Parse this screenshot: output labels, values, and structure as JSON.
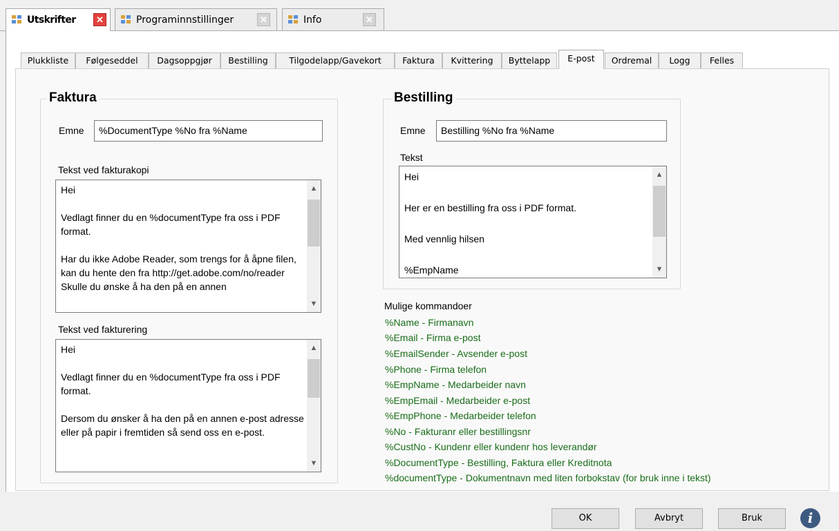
{
  "doc_tabs": [
    {
      "label": "Utskrifter",
      "active": true
    },
    {
      "label": "Programinnstillinger",
      "active": false
    },
    {
      "label": "Info",
      "active": false
    }
  ],
  "inner_tabs": [
    "Plukkliste",
    "Følgeseddel",
    "Dagsoppgjør",
    "Bestilling",
    "Tilgodelapp/Gavekort",
    "Faktura",
    "Kvittering",
    "Byttelapp",
    "E-post",
    "Ordremal",
    "Logg",
    "Felles"
  ],
  "active_inner_tab": "E-post",
  "faktura": {
    "title": "Faktura",
    "subject_label": "Emne",
    "subject_value": "%DocumentType %No fra %Name",
    "copy_label": "Tekst ved fakturakopi",
    "copy_text": "Hei\n\nVedlagt finner du en %documentType fra oss i PDF format.\n\nHar du ikke Adobe Reader, som trengs for å åpne filen, kan du hente den fra http://get.adobe.com/no/reader\nSkulle du ønske å ha den på en annen",
    "invoice_label": "Tekst ved fakturering",
    "invoice_text": "Hei\n\nVedlagt finner du en %documentType fra oss i PDF format.\n\nDersom du ønsker å ha den på en annen e-post adresse eller på papir i fremtiden så send oss en e-post."
  },
  "bestilling": {
    "title": "Bestilling",
    "subject_label": "Emne",
    "subject_value": "Bestilling %No fra %Name",
    "text_label": "Tekst",
    "text": "Hei\n\nHer er en bestilling fra oss i PDF format.\n\nMed vennlig hilsen\n\n%EmpName"
  },
  "commands": {
    "title": "Mulige kommandoer",
    "items": [
      "%Name - Firmanavn",
      "%Email - Firma e-post",
      "%EmailSender - Avsender e-post",
      "%Phone - Firma telefon",
      "%EmpName - Medarbeider navn",
      "%EmpEmail - Medarbeider e-post",
      "%EmpPhone - Medarbeider telefon",
      "%No - Fakturanr eller bestillingsnr",
      "%CustNo - Kundenr eller kundenr hos leverandør",
      "%DocumentType - Bestilling, Faktura eller Kreditnota",
      "%documentType - Dokumentnavn med liten forbokstav (for bruk inne i tekst)"
    ]
  },
  "buttons": {
    "ok": "OK",
    "cancel": "Avbryt",
    "apply": "Bruk",
    "info_glyph": "i"
  },
  "colors": {
    "command_text": "#1a6d1a",
    "close_active": "#e3413f",
    "info_button": "#3d5a80"
  }
}
